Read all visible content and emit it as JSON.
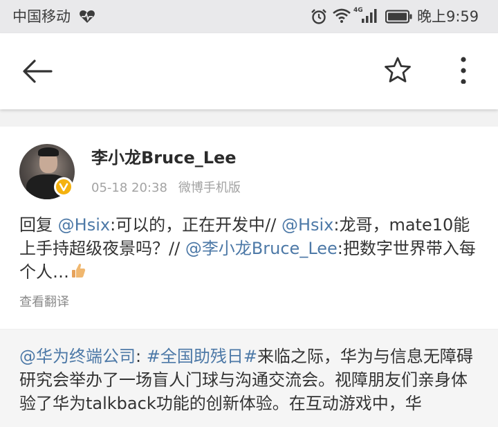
{
  "status_bar": {
    "carrier": "中国移动",
    "network_type": "4G",
    "time": "晚上9:59",
    "icons": [
      "heart-icon",
      "alarm-icon",
      "wifi-icon",
      "signal-icon",
      "battery-icon"
    ]
  },
  "toolbar": {
    "icons": [
      "back-arrow-icon",
      "star-icon",
      "more-vertical-icon"
    ]
  },
  "post": {
    "username": "李小龙Bruce_Lee",
    "timestamp": "05-18 20:38",
    "source": "微博手机版",
    "text": {
      "reply_prefix": "回复 ",
      "mention_1": "@Hsix",
      "part_1": ":可以的，正在开发中// ",
      "mention_2": "@Hsix",
      "part_2": ":龙哥，mate10能上手持超级夜景吗？// ",
      "mention_3": "@李小龙Bruce_Lee",
      "part_3": ":把数字世界带入每个人…",
      "emoji": "thumbs-up-icon"
    },
    "translate_label": "查看翻译"
  },
  "repost": {
    "mention": "@华为终端公司",
    "separator": ": ",
    "hashtag": "#全国助残日#",
    "text": "来临之际，华为与信息无障碍研究会举办了一场盲人门球与沟通交流会。视障朋友们亲身体验了华为talkback功能的创新体验。在互动游戏中，华"
  },
  "colors": {
    "link": "#4d79a7",
    "status_bar_bg": "#e9e9eb",
    "verified_badge": "#f4b20f"
  }
}
